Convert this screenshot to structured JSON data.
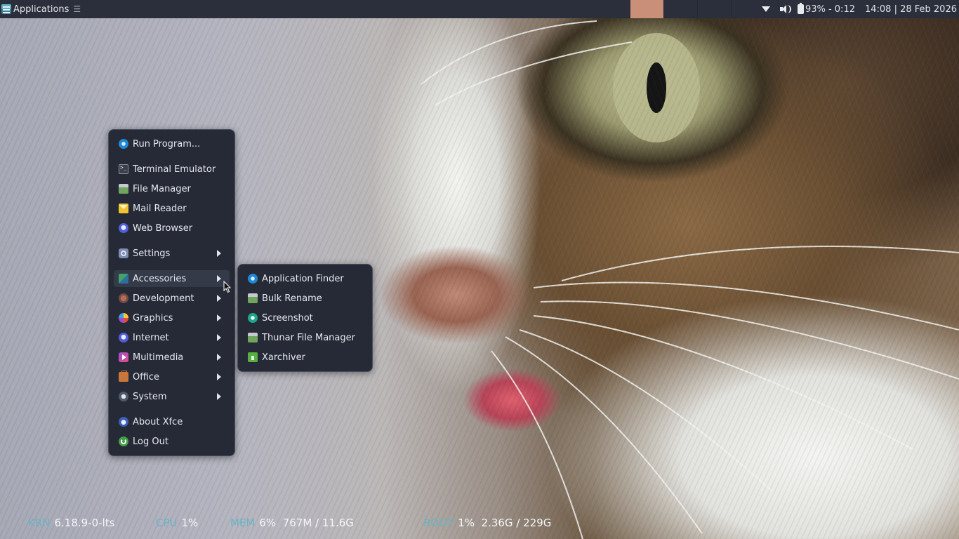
{
  "panel": {
    "applications_label": "Applications",
    "handle_glyph": "☰",
    "battery": "93% - 0:12",
    "clock": "14:08 | 28 Feb 2026",
    "icons": [
      "applications-icon",
      "wifi-icon",
      "volume-icon",
      "battery-icon"
    ]
  },
  "main_menu": {
    "items": [
      {
        "label": "Run Program...",
        "icon": "run-icon"
      },
      {
        "label": "Terminal Emulator",
        "icon": "terminal-icon"
      },
      {
        "label": "File Manager",
        "icon": "folder-icon"
      },
      {
        "label": "Mail Reader",
        "icon": "mail-icon"
      },
      {
        "label": "Web Browser",
        "icon": "globe-icon"
      },
      {
        "label": "Settings",
        "icon": "settings-icon",
        "submenu": true
      },
      {
        "label": "Accessories",
        "icon": "accessories-icon",
        "submenu": true,
        "active": true
      },
      {
        "label": "Development",
        "icon": "development-icon",
        "submenu": true
      },
      {
        "label": "Graphics",
        "icon": "graphics-icon",
        "submenu": true
      },
      {
        "label": "Internet",
        "icon": "internet-icon",
        "submenu": true
      },
      {
        "label": "Multimedia",
        "icon": "multimedia-icon",
        "submenu": true
      },
      {
        "label": "Office",
        "icon": "office-icon",
        "submenu": true
      },
      {
        "label": "System",
        "icon": "system-icon",
        "submenu": true
      },
      {
        "label": "About Xfce",
        "icon": "xfce-icon"
      },
      {
        "label": "Log Out",
        "icon": "logout-icon"
      }
    ]
  },
  "accessories_menu": {
    "items": [
      {
        "label": "Application Finder",
        "icon": "search-icon"
      },
      {
        "label": "Bulk Rename",
        "icon": "rename-icon"
      },
      {
        "label": "Screenshot",
        "icon": "screenshot-icon"
      },
      {
        "label": "Thunar File Manager",
        "icon": "folder-icon"
      },
      {
        "label": "Xarchiver",
        "icon": "archive-icon"
      }
    ]
  },
  "conky": {
    "krn": {
      "key": "KRN",
      "value": "6.18.9-0-lts"
    },
    "cpu": {
      "key": "CPU",
      "value": "1%"
    },
    "mem": {
      "key": "MEM",
      "value": "6%  767M / 11.6G"
    },
    "root": {
      "key": "ROOT",
      "value": "1%  2.36G / 229G"
    }
  },
  "colors": {
    "panel_bg": "#2b2f3b",
    "menu_bg": "#262a37",
    "conky_key": "#6ab3c4",
    "active_workspace": "#c98f78"
  }
}
